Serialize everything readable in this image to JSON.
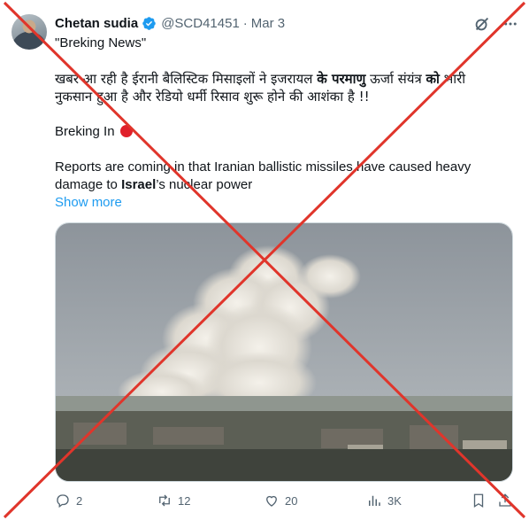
{
  "tweet": {
    "author_name": "Chetan sudia",
    "handle": "@SCD41451",
    "separator": "·",
    "date": "Mar 3",
    "lines": {
      "l1": "\"Breking News\"",
      "hindi1_a": "खबर आ रही है ईरानी बैलिस्टिक मिसाइलों ने इजरायल ",
      "hindi1_b": "के परमाणु",
      "hindi1_c": " ऊर्जा संयंत्र ",
      "hindi1_d": "को",
      "hindi1_e": " भारी",
      "hindi2": "नुकसान हुआ है और रेडियो धर्मी रिसाव शुरू होने की आशंका है !!",
      "breaking": "Breking In",
      "en1": "Reports are coming in that Iranian ballistic missiles have caused heavy",
      "en2_a": "damage to ",
      "en2_b": "Israel",
      "en2_c": "’s nuclear power"
    },
    "show_more": "Show more",
    "actions": {
      "replies": "2",
      "reposts": "12",
      "likes": "20",
      "views": "3K"
    }
  },
  "icons": {
    "verified": "verified-badge-icon",
    "grok": "grok-icon",
    "more": "more-icon",
    "reply": "reply-icon",
    "repost": "repost-icon",
    "like": "like-icon",
    "views": "views-icon",
    "bookmark": "bookmark-icon",
    "share": "share-icon"
  },
  "colors": {
    "accent": "#1d9bf0",
    "cross": "#e0352b",
    "muted": "#536471",
    "breaking_dot": "#e0202a"
  }
}
